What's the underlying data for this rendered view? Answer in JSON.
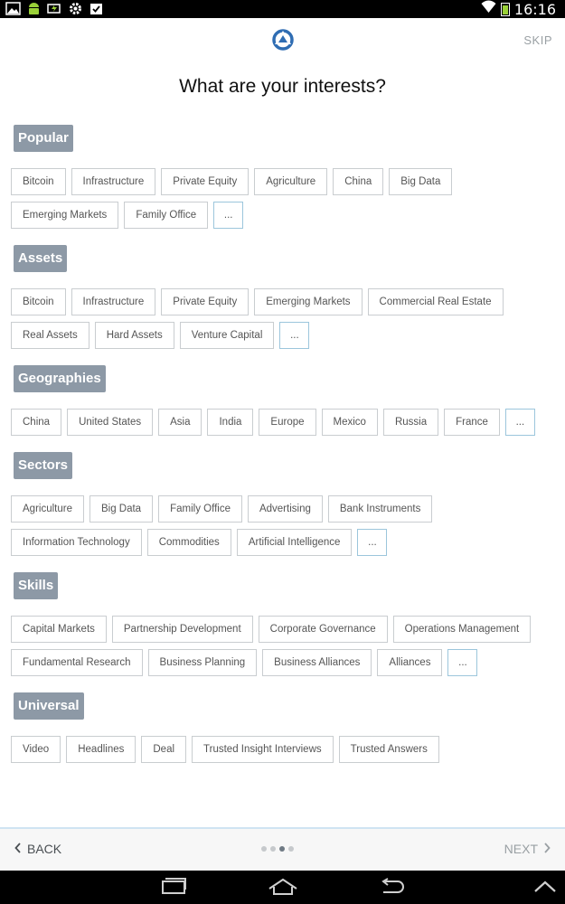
{
  "status_bar": {
    "time": "16:16",
    "icons": [
      "image-icon",
      "android-icon",
      "battery-charging-icon",
      "gear-icon",
      "clipboard-icon",
      "wifi-icon",
      "battery-icon"
    ]
  },
  "header": {
    "skip_label": "SKIP",
    "title": "What are your interests?"
  },
  "sections": [
    {
      "name": "Popular",
      "tags": [
        "Bitcoin",
        "Infrastructure",
        "Private Equity",
        "Agriculture",
        "China",
        "Big Data",
        "Emerging Markets",
        "Family Office"
      ],
      "more_label": "..."
    },
    {
      "name": "Assets",
      "tags": [
        "Bitcoin",
        "Infrastructure",
        "Private Equity",
        "Emerging Markets",
        "Commercial Real Estate",
        "Real Assets",
        "Hard Assets",
        "Venture Capital"
      ],
      "more_label": "..."
    },
    {
      "name": "Geographies",
      "tags": [
        "China",
        "United States",
        "Asia",
        "India",
        "Europe",
        "Mexico",
        "Russia",
        "France"
      ],
      "more_label": "..."
    },
    {
      "name": "Sectors",
      "tags": [
        "Agriculture",
        "Big Data",
        "Family Office",
        "Advertising",
        "Bank Instruments",
        "Information Technology",
        "Commodities",
        "Artificial Intelligence"
      ],
      "more_label": "..."
    },
    {
      "name": "Skills",
      "tags": [
        "Capital Markets",
        "Partnership Development",
        "Corporate Governance",
        "Operations Management",
        "Fundamental Research",
        "Business Planning",
        "Business Alliances",
        "Alliances"
      ],
      "more_label": "..."
    },
    {
      "name": "Universal",
      "tags": [
        "Video",
        "Headlines",
        "Deal",
        "Trusted Insight Interviews",
        "Trusted Answers"
      ]
    }
  ],
  "footer": {
    "back_label": "BACK",
    "next_label": "NEXT",
    "pages": 4,
    "active_page": 3
  },
  "colors": {
    "section_header_bg": "#8d99a6",
    "tag_border": "#c9cdd0",
    "more_border": "#9cc6dc",
    "logo_blue": "#2f6db3"
  }
}
